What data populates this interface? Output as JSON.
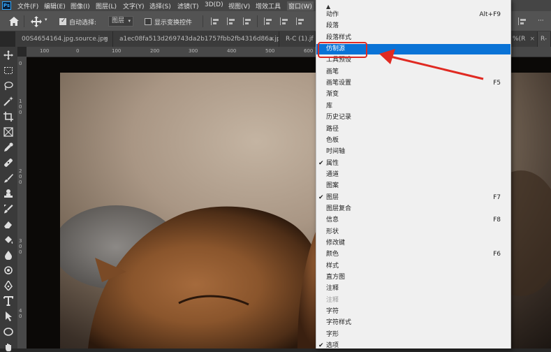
{
  "menubar": {
    "logo": "Ps",
    "items": [
      "文件(F)",
      "编辑(E)",
      "图像(I)",
      "图层(L)",
      "文字(Y)",
      "选择(S)",
      "滤镜(T)",
      "3D(D)",
      "视图(V)",
      "增效工具",
      "窗口(W)"
    ]
  },
  "options": {
    "auto_select_label": "自动选择:",
    "auto_select_value": "图层",
    "show_transform_label": "显示变换控件"
  },
  "tabs": [
    {
      "label": "00S4654164.jpg.source.jpg",
      "close": "×"
    },
    {
      "label": "a1ec08fa513d269743da2b1757fbb2fb4316d86a.jpg",
      "close": "×"
    },
    {
      "label": "R-C (1).jf",
      "close": ""
    },
    {
      "label": "%(R",
      "close": "×"
    },
    {
      "label": "R-",
      "close": ""
    }
  ],
  "ruler": {
    "top": [
      "100",
      "0",
      "100",
      "200",
      "300",
      "400",
      "500",
      "600"
    ],
    "left": [
      "0",
      "1",
      "0",
      "0",
      "2",
      "0",
      "0",
      "3",
      "0",
      "0",
      "4",
      "0"
    ]
  },
  "window_menu": {
    "scroll_up": "▲",
    "items": [
      {
        "label": "动作",
        "shortcut": "Alt+F9"
      },
      {
        "label": "段落",
        "shortcut": ""
      },
      {
        "label": "段落样式",
        "shortcut": ""
      },
      {
        "label": "仿制源",
        "shortcut": "",
        "highlighted": true
      },
      {
        "label": "工具预设",
        "shortcut": ""
      },
      {
        "label": "画笔",
        "shortcut": ""
      },
      {
        "label": "画笔设置",
        "shortcut": "F5"
      },
      {
        "label": "渐变",
        "shortcut": ""
      },
      {
        "label": "库",
        "shortcut": ""
      },
      {
        "label": "历史记录",
        "shortcut": ""
      },
      {
        "label": "路径",
        "shortcut": ""
      },
      {
        "label": "色板",
        "shortcut": ""
      },
      {
        "label": "时间轴",
        "shortcut": ""
      },
      {
        "label": "属性",
        "shortcut": "",
        "checked": true
      },
      {
        "label": "通道",
        "shortcut": ""
      },
      {
        "label": "图案",
        "shortcut": ""
      },
      {
        "label": "图层",
        "shortcut": "F7",
        "checked": true
      },
      {
        "label": "图层复合",
        "shortcut": ""
      },
      {
        "label": "信息",
        "shortcut": "F8"
      },
      {
        "label": "形状",
        "shortcut": ""
      },
      {
        "label": "修改键",
        "shortcut": ""
      },
      {
        "label": "颜色",
        "shortcut": "F6"
      },
      {
        "label": "样式",
        "shortcut": ""
      },
      {
        "label": "直方图",
        "shortcut": ""
      },
      {
        "label": "注释",
        "shortcut": ""
      },
      {
        "label": "注释",
        "shortcut": "",
        "disabled": true
      },
      {
        "label": "字符",
        "shortcut": ""
      },
      {
        "label": "字符样式",
        "shortcut": ""
      },
      {
        "label": "字形",
        "shortcut": ""
      },
      {
        "label": "选项",
        "shortcut": "",
        "checked": true
      }
    ]
  },
  "colors": {
    "highlight": "#0a73d6",
    "annotation": "#e02a22"
  }
}
